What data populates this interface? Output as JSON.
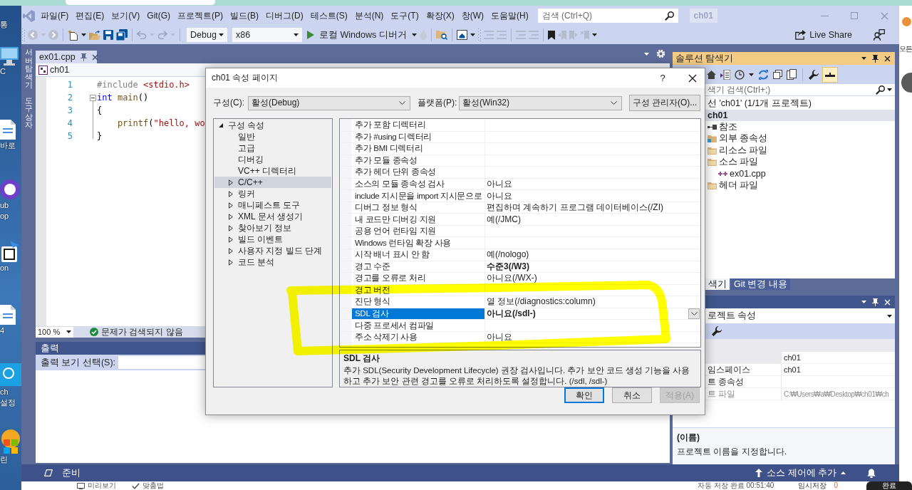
{
  "desktop": {
    "icons": [
      {
        "kind": "none",
        "lines": [
          "통"
        ]
      },
      {
        "kind": "monitor",
        "lines": [
          "C"
        ]
      },
      {
        "kind": "document",
        "lines": [
          "바로"
        ]
      },
      {
        "kind": "disc",
        "lines": [
          "ub",
          "op"
        ]
      },
      {
        "kind": "package",
        "lines": [
          "on"
        ]
      },
      {
        "kind": "document",
        "lines": [
          "4"
        ]
      },
      {
        "kind": "tile",
        "lines": [
          "ch",
          "설정"
        ]
      },
      {
        "kind": "shield",
        "lines": [
          "린"
        ]
      }
    ],
    "corner_text": "모든"
  },
  "window": {
    "menu": [
      "파일(F)",
      "편집(E)",
      "보기(V)",
      "Git(G)",
      "프로젝트(P)",
      "빌드(B)",
      "디버그(D)",
      "테스트(S)",
      "분석(N)",
      "도구(T)",
      "확장(X)",
      "창(W)",
      "도움말(H)"
    ],
    "search": {
      "placeholder": "검색 (Ctrl+Q)"
    },
    "solution_name": "ch01"
  },
  "toolbar": {
    "configuration": "Debug",
    "platform": "x86",
    "run_button": "로컬 Windows 디버거",
    "live_share": "Live Share"
  },
  "side_tabs": [
    "서버 탐색기",
    "도구 상자"
  ],
  "editor": {
    "tabs": [
      {
        "label": "ex01.cpp",
        "selected": true
      }
    ],
    "scope": "ch01",
    "lines": [
      {
        "number": "1",
        "kind": "plain",
        "tokens": [
          {
            "text": "#include",
            "kind": "preprocessor"
          },
          {
            "text": " <stdio.h>",
            "kind": "string"
          }
        ]
      },
      {
        "number": "2",
        "kind": "opener",
        "tokens": [
          {
            "text": "int",
            "kind": "keyword"
          },
          {
            "text": " main",
            "kind": "function"
          },
          {
            "text": "()",
            "kind": "plain"
          }
        ]
      },
      {
        "number": "3",
        "kind": "inner",
        "tokens": [
          {
            "text": "{",
            "kind": "plain"
          }
        ]
      },
      {
        "number": "4",
        "kind": "inner",
        "tokens": [
          {
            "text": "    printf",
            "kind": "function"
          },
          {
            "text": "(",
            "kind": "plain"
          },
          {
            "text": "\"hello, wo",
            "kind": "string"
          }
        ]
      },
      {
        "number": "5",
        "kind": "closer",
        "tokens": [
          {
            "text": "}",
            "kind": "plain"
          }
        ]
      }
    ],
    "zoom": "100 %",
    "status": "문제가 검색되지 않음"
  },
  "output": {
    "title": "출력",
    "source_label": "출력 보기 선택(S):"
  },
  "solution_explorer": {
    "title": "솔루션 탐색기",
    "preview_toggle": {
      "on": true
    },
    "search": {
      "placeholder": "색기 검색(Ctrl+;)"
    },
    "tree": [
      {
        "label": "선 'ch01' (1/1개 프로젝트)",
        "selected": false,
        "startup": false,
        "children": [
          {
            "label": "ch01",
            "selected": true,
            "startup": true,
            "children": [
              {
                "label": "참조",
                "kind": "references",
                "selected": false,
                "startup": false
              },
              {
                "label": "외부 종속성",
                "kind": "external",
                "selected": false,
                "startup": false
              },
              {
                "label": "리소스 파일",
                "kind": "folder",
                "selected": false,
                "startup": false
              },
              {
                "label": "소스 파일",
                "kind": "folder",
                "selected": false,
                "startup": false,
                "children": [
                  {
                    "label": "ex01.cpp",
                    "kind": "cpp",
                    "selected": false,
                    "startup": false
                  }
                ]
              },
              {
                "label": "헤더 파일",
                "kind": "folder",
                "selected": false,
                "startup": false
              }
            ]
          }
        ]
      }
    ],
    "tabs": [
      {
        "label": "색기",
        "selected": true
      },
      {
        "label": "Git 변경 내용",
        "selected": false
      }
    ]
  },
  "properties": {
    "object": "로젝트 속성",
    "rows": [
      {
        "value": "ch01",
        "selected": true,
        "readonly": false
      },
      {
        "name": "임스페이스",
        "value": "ch01",
        "selected": false,
        "readonly": false
      },
      {
        "name": "트 종속성",
        "selected": false,
        "readonly": false
      },
      {
        "name": "트 파일",
        "value": "C:₩Users₩a₩Desktop₩ch01₩ch",
        "selected": false,
        "readonly": true
      }
    ],
    "description": {
      "title": "(이름)",
      "text": "프로젝트 이름을 지정합니다."
    }
  },
  "status_bar": {
    "text": "준비",
    "source_control": "소스 제어에 추가"
  },
  "footer": {
    "items": [
      "미리보기",
      "맞춤법"
    ],
    "autosave": "자동 저장 완료 00:51:40",
    "draft": "임시저장",
    "draft_count": "0",
    "done": "완료"
  },
  "dialog": {
    "title": "ch01 속성 페이지",
    "help": "?",
    "configuration": {
      "label": "구성(C):",
      "value": "활성(Debug)"
    },
    "platform": {
      "label": "플랫폼(P):",
      "value": "활성(Win32)"
    },
    "manager_button": "구성 관리자(O)...",
    "tree": [
      {
        "label": "구성 속성",
        "expanded": true,
        "selected": false,
        "children": [
          {
            "label": "일반",
            "selected": false
          },
          {
            "label": "고급",
            "selected": false
          },
          {
            "label": "디버깅",
            "selected": false
          },
          {
            "label": "VC++ 디렉터리",
            "selected": false
          },
          {
            "label": "C/C++",
            "expanded": false,
            "selected": true
          },
          {
            "label": "링커",
            "expanded": false,
            "selected": false
          },
          {
            "label": "매니페스트 도구",
            "expanded": false,
            "selected": false
          },
          {
            "label": "XML 문서 생성기",
            "expanded": false,
            "selected": false
          },
          {
            "label": "찾아보기 정보",
            "expanded": false,
            "selected": false
          },
          {
            "label": "빌드 이벤트",
            "expanded": false,
            "selected": false
          },
          {
            "label": "사용자 지정 빌드 단계",
            "expanded": false,
            "selected": false
          },
          {
            "label": "코드 분석",
            "expanded": false,
            "selected": false
          }
        ]
      }
    ],
    "properties": [
      {
        "name": "추가 포함 디렉터리",
        "selected": false
      },
      {
        "name": "추가 #using 디렉터리",
        "selected": false
      },
      {
        "name": "추가 BMI 디렉터리",
        "selected": false
      },
      {
        "name": "추가 모듈 종속성",
        "selected": false
      },
      {
        "name": "추가 헤더 단위 종속성",
        "selected": false
      },
      {
        "name": "소스의 모듈 종속성 검사",
        "value": "아니요",
        "modified": false,
        "selected": false
      },
      {
        "name": "include 지시문을 import 지시문으로",
        "value": "아니요",
        "modified": false,
        "selected": false
      },
      {
        "name": "디버그 정보 형식",
        "value": "편집하며 계속하기 프로그램 데이터베이스(/ZI)",
        "modified": false,
        "selected": false
      },
      {
        "name": "내 코드만 디버깅 지원",
        "value": "예(/JMC)",
        "modified": false,
        "selected": false
      },
      {
        "name": "공용 언어 런타임 지원",
        "selected": false
      },
      {
        "name": "Windows 런타임 확장 사용",
        "selected": false
      },
      {
        "name": "시작 배너 표시 안 함",
        "value": "예(/nologo)",
        "modified": false,
        "selected": false
      },
      {
        "name": "경고 수준",
        "value": "수준3(/W3)",
        "modified": true,
        "selected": false
      },
      {
        "name": "경고를 오류로 처리",
        "value": "아니요(/WX-)",
        "modified": false,
        "selected": false
      },
      {
        "name": "경고 버전",
        "selected": false
      },
      {
        "name": "진단 형식",
        "value": "열 정보(/diagnostics:column)",
        "modified": false,
        "selected": false
      },
      {
        "name": "SDL 검사",
        "value": "아니요(/sdl-)",
        "modified": true,
        "selected": true
      },
      {
        "name": "다중 프로세서 컴파일",
        "selected": false
      },
      {
        "name": "주소 삭제기 사용",
        "value": "아니요",
        "modified": false,
        "selected": false
      }
    ],
    "description": {
      "title": "SDL 검사",
      "text": "추가 SDL(Security Development Lifecycle) 권장 검사입니다. 추가 보안 코드 생성 기능을 사용하고 추가 보안 관련 경고를 오류로 처리하도록 설정합니다. (/sdl, /sdl-)"
    },
    "buttons": [
      {
        "label": "확인",
        "default": true,
        "disabled": false
      },
      {
        "label": "취소",
        "default": false,
        "disabled": false
      },
      {
        "label": "적용(A)",
        "default": false,
        "disabled": true
      }
    ]
  }
}
